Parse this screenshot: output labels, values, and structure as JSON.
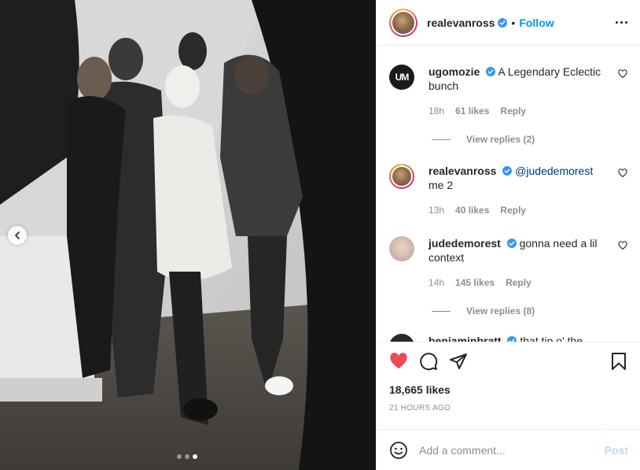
{
  "post": {
    "author": "realevanross",
    "follow_label": "Follow",
    "bullet": "•",
    "likes": "18,665 likes",
    "timestamp": "21 HOURS AGO",
    "carousel": {
      "slides": 3,
      "active_index": 2
    }
  },
  "comments": [
    {
      "user": "ugomozie",
      "text": "A Legendary Eclectic bunch",
      "time": "18h",
      "likes": "61 likes",
      "reply_label": "Reply",
      "view_replies": "View replies (2)"
    },
    {
      "user": "realevanross",
      "mention": "@judedemorest",
      "text": "me 2",
      "time": "13h",
      "likes": "40 likes",
      "reply_label": "Reply"
    },
    {
      "user": "judedemorest",
      "text": "gonna need a lil context",
      "time": "14h",
      "likes": "145 likes",
      "reply_label": "Reply",
      "view_replies": "View replies (8)"
    },
    {
      "user": "benjaminbratt",
      "text": "that tip o' the"
    }
  ],
  "composer": {
    "placeholder": "Add a comment...",
    "post_label": "Post"
  },
  "colors": {
    "accent": "#0095f6",
    "like_red": "#ed4956",
    "muted": "#8e8e8e",
    "verified": "#3897f0"
  },
  "icons": [
    "chevron-left-icon",
    "verified-badge-icon",
    "more-icon",
    "heart-icon",
    "comment-icon",
    "share-icon",
    "bookmark-icon",
    "emoji-icon"
  ]
}
